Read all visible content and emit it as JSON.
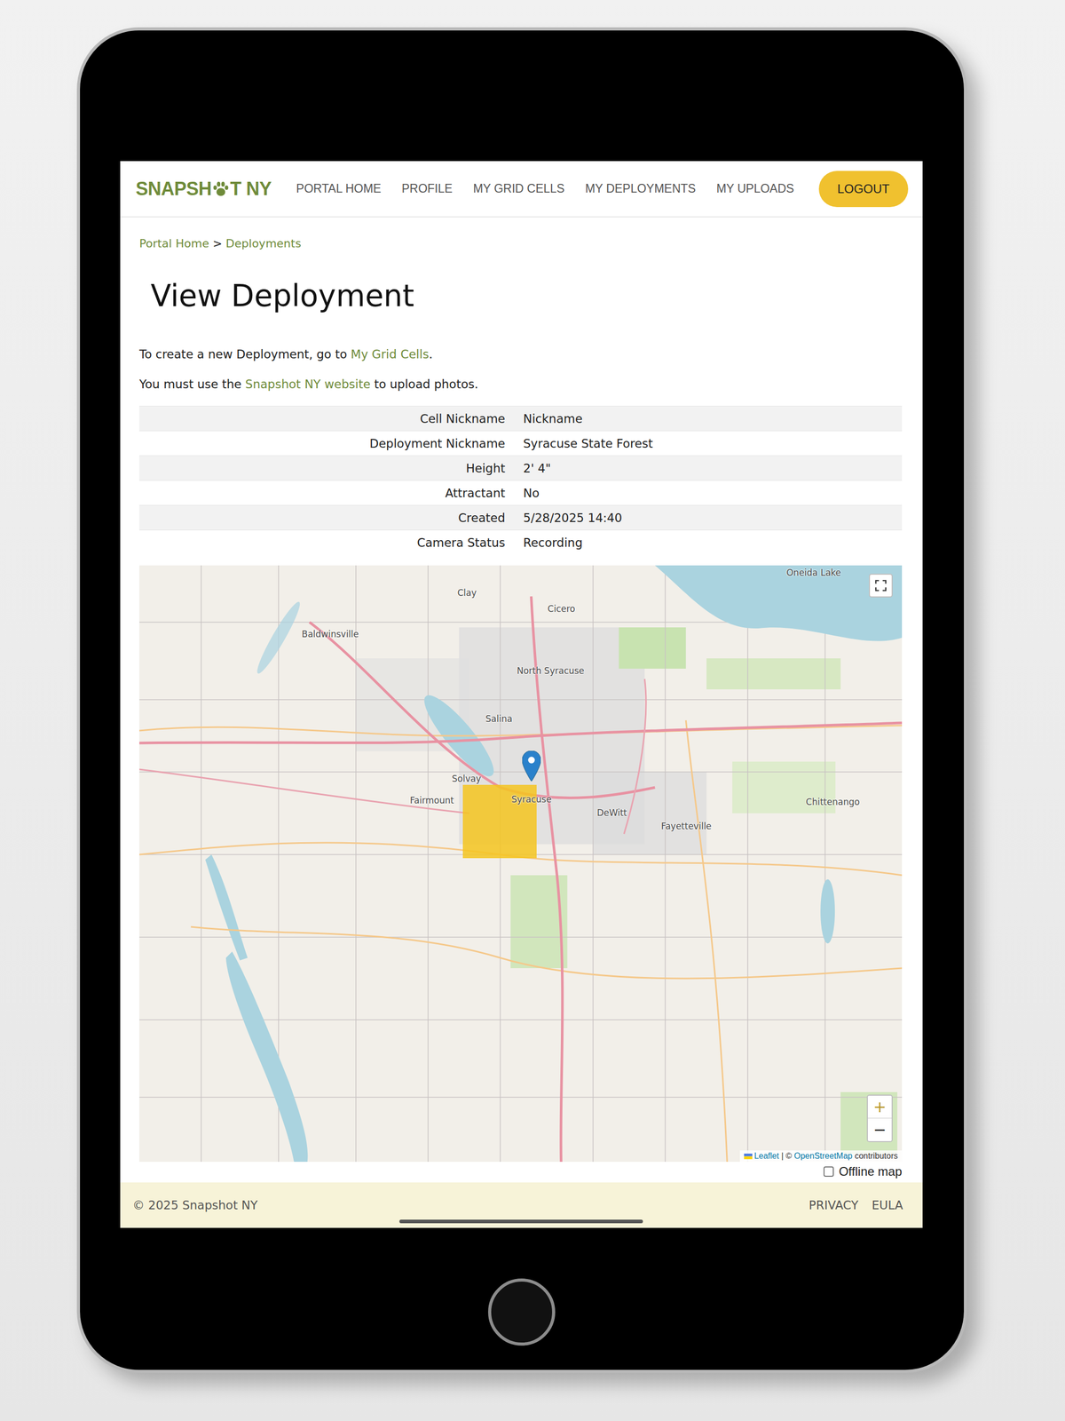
{
  "header": {
    "logo": {
      "before": "SNAPSH",
      "after": "T NY"
    },
    "nav": [
      {
        "label": "PORTAL HOME"
      },
      {
        "label": "PROFILE"
      },
      {
        "label": "MY GRID CELLS"
      },
      {
        "label": "MY DEPLOYMENTS"
      },
      {
        "label": "MY UPLOADS"
      }
    ],
    "logout": "LOGOUT"
  },
  "breadcrumb": {
    "items": [
      {
        "label": "Portal Home"
      },
      {
        "label": "Deployments"
      }
    ],
    "separator": ">"
  },
  "title": "View Deployment",
  "notes": [
    {
      "before": "To create a new Deployment, go to ",
      "link": "My Grid Cells",
      "after": "."
    },
    {
      "before": "You must use the ",
      "link": "Snapshot NY website",
      "after": " to upload photos."
    }
  ],
  "details": [
    {
      "label": "Cell Nickname",
      "value": "Nickname"
    },
    {
      "label": "Deployment Nickname",
      "value": "Syracuse State Forest"
    },
    {
      "label": "Height",
      "value": "2' 4\""
    },
    {
      "label": "Attractant",
      "value": "No"
    },
    {
      "label": "Created",
      "value": "5/28/2025 14:40"
    },
    {
      "label": "Camera Status",
      "value": "Recording"
    }
  ],
  "map": {
    "labels": [
      "Oneida Lake",
      "Clay",
      "Cicero",
      "Baldwinsville",
      "North Syracuse",
      "Salina",
      "Solvay",
      "Fairmount",
      "Syracuse",
      "DeWitt",
      "Fayetteville",
      "Chittenango"
    ],
    "zoom_in": "+",
    "zoom_out": "−",
    "attribution": {
      "leaflet": "Leaflet",
      "separator": " | © ",
      "osm": "OpenStreetMap",
      "after": " contributors"
    },
    "offline": {
      "label": "Offline map",
      "checked": false
    }
  },
  "footer": {
    "copyright": "© 2025 Snapshot NY",
    "links": [
      "PRIVACY",
      "EULA"
    ]
  }
}
